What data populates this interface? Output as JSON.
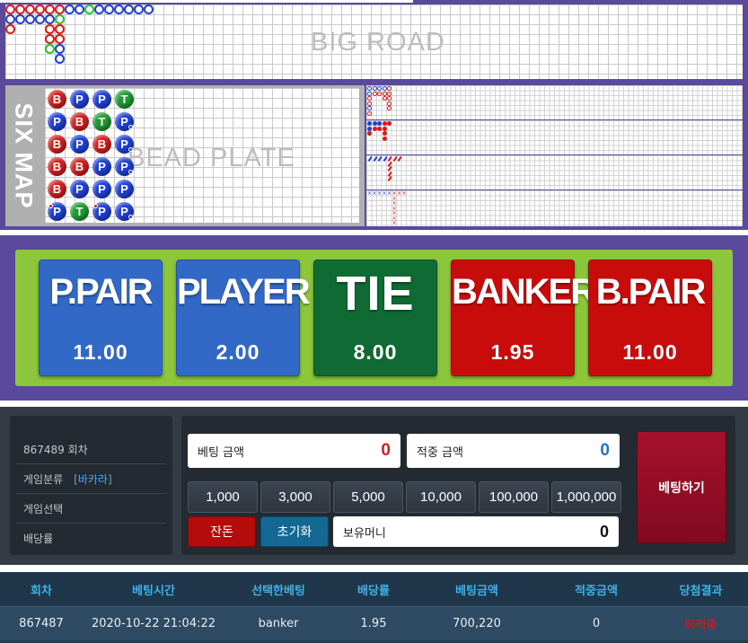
{
  "roads": {
    "big_road_title": "BIG ROAD",
    "six_map_title": "SIX MAP",
    "bead_plate_title": "BEAD PLATE",
    "big_road": [
      [
        "r",
        "b",
        "r"
      ],
      [
        "r",
        "b"
      ],
      [
        "r",
        "b"
      ],
      [
        "r",
        "b"
      ],
      [
        "r",
        "b",
        "r",
        "r",
        "g"
      ],
      [
        "r",
        "g",
        "r",
        "r",
        "b",
        "b"
      ],
      [
        "b"
      ],
      [
        "b"
      ],
      [
        "g"
      ],
      [
        "b"
      ],
      [
        "b"
      ],
      [
        "b"
      ],
      [
        "b"
      ],
      [
        "b"
      ],
      [
        "b"
      ]
    ],
    "bead_plate": [
      [
        "B",
        "P",
        "B",
        "B",
        "B",
        "P"
      ],
      [
        "P",
        "B",
        "P",
        "B",
        "P",
        "T"
      ],
      [
        "P",
        "T",
        "B",
        "P",
        "P",
        "P"
      ],
      [
        "T",
        "P",
        "P",
        "P",
        "P",
        "P"
      ]
    ],
    "bead_pairs": {
      "0-5": "bl",
      "3-1": "br",
      "2-5": "bl",
      "3-5": "br",
      "3-2": "br",
      "3-3": "br"
    },
    "derived_big_eye": [
      [
        "b",
        "b",
        "r",
        "r",
        "b",
        "r"
      ],
      [
        "b",
        "r"
      ],
      [
        "b",
        "r"
      ],
      [
        "b",
        "r",
        "r"
      ],
      [
        "r",
        "r",
        "r",
        "r",
        "r"
      ]
    ],
    "derived_small": [
      [
        "b",
        "b",
        "r"
      ],
      [
        "b",
        "r"
      ],
      [
        "b",
        "r"
      ],
      [
        "r",
        "r",
        "r",
        "r"
      ],
      [
        "r"
      ]
    ],
    "derived_cockroach": [
      [
        "b"
      ],
      [
        "b"
      ],
      [
        "b"
      ],
      [
        "b"
      ],
      [
        "r",
        "r",
        "r",
        "r",
        "r"
      ],
      [
        "r"
      ],
      [
        "r"
      ]
    ],
    "derived_x": [
      [
        "b"
      ],
      [
        "b"
      ],
      [
        "b"
      ],
      [
        "b"
      ],
      [
        "b"
      ],
      [
        "r",
        "r",
        "r",
        "r",
        "r",
        "r",
        "r"
      ],
      [
        "r"
      ],
      [
        "r"
      ]
    ]
  },
  "bets": {
    "p_pair": {
      "name": "P.PAIR",
      "odds": "11.00"
    },
    "player": {
      "name": "PLAYER",
      "odds": "2.00"
    },
    "tie": {
      "name": "TIE",
      "odds": "8.00"
    },
    "banker": {
      "name": "BANKER",
      "odds": "1.95"
    },
    "b_pair": {
      "name": "B.PAIR",
      "odds": "11.00"
    }
  },
  "info": {
    "round": "867489 회차",
    "game_type_label": "게임분류",
    "game_type_value": "[바카라]",
    "game_select_label": "게임선택",
    "odds_label": "배당률"
  },
  "betting": {
    "bet_amount_label": "베팅 금액",
    "bet_amount_value": "0",
    "win_amount_label": "적중 금액",
    "win_amount_value": "0",
    "chips": [
      "1,000",
      "3,000",
      "5,000",
      "10,000",
      "100,000",
      "1,000,000"
    ],
    "all_in_label": "잔돈",
    "reset_label": "초기화",
    "balance_label": "보유머니",
    "balance_value": "0",
    "place_bet_label": "베팅하기",
    "colors": {
      "bet_amount": "#e01818",
      "win_amount": "#1e73d6"
    }
  },
  "history": {
    "headers": [
      "회차",
      "베팅시간",
      "선택한베팅",
      "배당률",
      "베팅금액",
      "적중금액",
      "당첨결과"
    ],
    "rows": [
      [
        "867487",
        "2020-10-22 21:04:22",
        "banker",
        "1.95",
        "700,220",
        "0",
        "미적중"
      ]
    ]
  }
}
